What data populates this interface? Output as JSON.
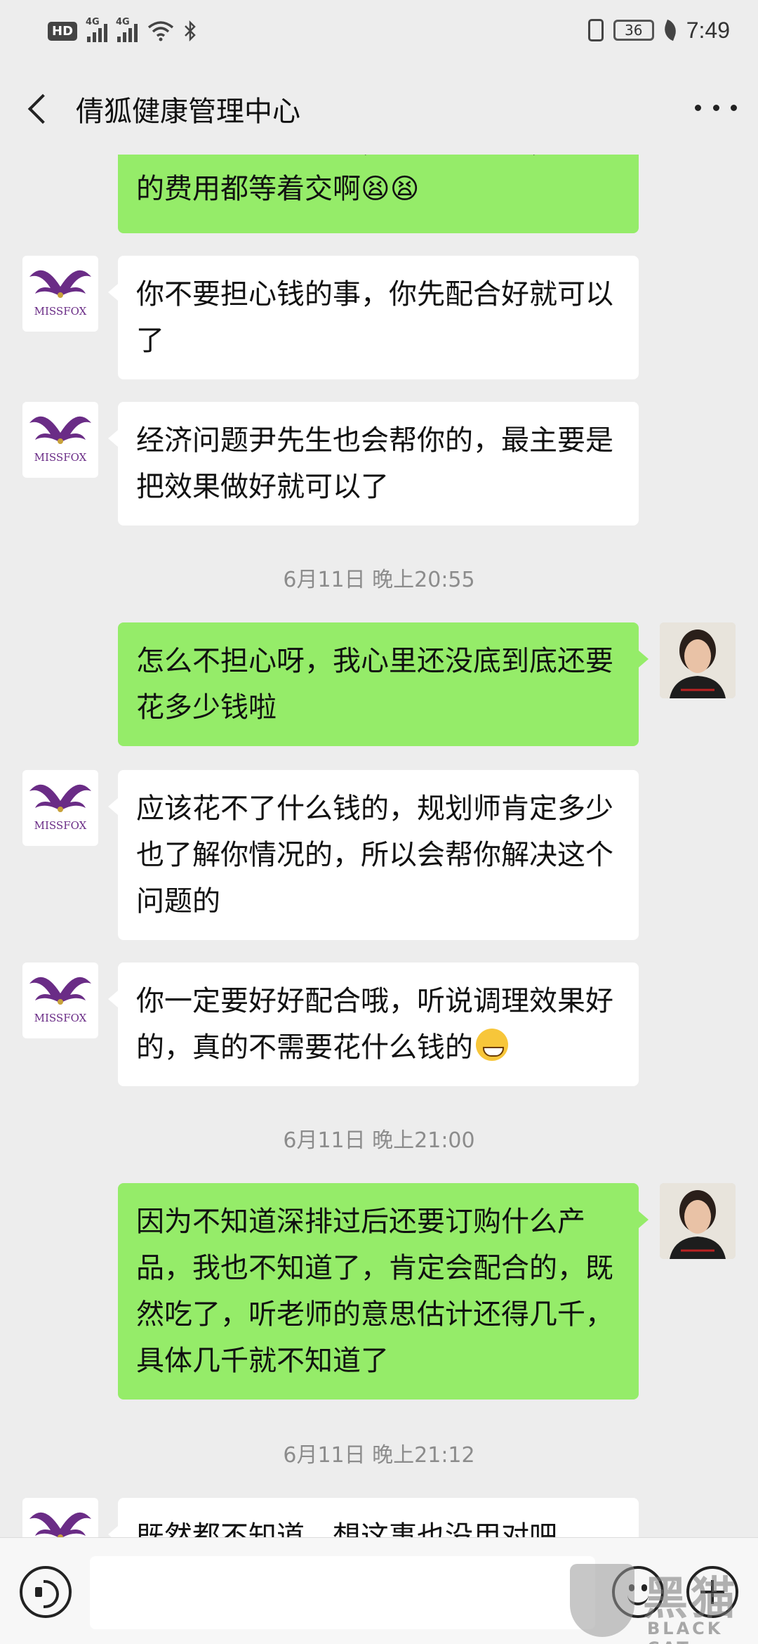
{
  "status_bar": {
    "hd": "HD",
    "sim1": "4G",
    "sim2": "4G",
    "battery": "36",
    "time": "7:49"
  },
  "header": {
    "title": "倩狐健康管理中心"
  },
  "messages": [
    {
      "side": "out",
      "text": "考虑这段时间吃呀，补习的费用，学校的费用都等着交啊😫😫"
    },
    {
      "side": "in",
      "text": "你不要担心钱的事，你先配合好就可以了"
    },
    {
      "side": "in",
      "text": "经济问题尹先生也会帮你的，最主要是把效果做好就可以了"
    },
    {
      "side": "out",
      "text": "怎么不担心呀，我心里还没底到底还要花多少钱啦"
    },
    {
      "side": "in",
      "text": "应该花不了什么钱的，规划师肯定多少也了解你情况的，所以会帮你解决这个问题的"
    },
    {
      "side": "in",
      "text": "你一定要好好配合哦，听说调理效果好的，真的不需要花什么钱的"
    },
    {
      "side": "out",
      "text": "因为不知道深排过后还要订购什么产品，我也不知道了，肯定会配合的，既然吃了，听老师的意思估计还得几千，具体几千就不知道了"
    },
    {
      "side": "in",
      "text": "既然都不知道，想这事也没用对吧"
    }
  ],
  "timestamps": [
    "6月11日 晚上20:55",
    "6月11日 晚上21:00",
    "6月11日 晚上21:12"
  ],
  "avatar": {
    "shop_label": "MISSFOX"
  },
  "watermark": {
    "cn": "黑猫",
    "en": "BLACK CAT"
  }
}
